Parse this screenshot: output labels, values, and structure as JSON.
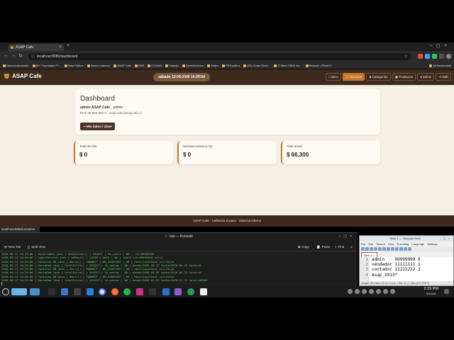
{
  "browser": {
    "tab_title": "ASAP Cafe",
    "new_tab": "+",
    "url": "localhost:8080/dashboard",
    "bookmarks": [
      "Demo/colorandrio",
      "40+ Foundation™...",
      "Java Python",
      "Nuevo carbono",
      "ASAP Cafe",
      "DBS",
      "CASADI",
      "Trabajo",
      "CyberDefense",
      "Viajes",
      "PR/Ladillos",
      "(21) Como Decir...",
      "17 Best OBDII An...",
      "Resume | FlowCV"
    ],
    "all_bookmarks": "All Bookmarks",
    "status_url": "localhost:8080/usuarios"
  },
  "app": {
    "brand": "ASAP Cafe",
    "datetime": "sábado 12-09-2026 14:29:54",
    "nav": [
      {
        "label": "Inicio",
        "icon": "home-icon",
        "active": false
      },
      {
        "label": "Usuarios",
        "icon": "users-icon",
        "active": true
      },
      {
        "label": "Categorías",
        "icon": "tag-icon",
        "active": false
      },
      {
        "label": "Productos",
        "icon": "box-icon",
        "active": false
      },
      {
        "label": "admin",
        "icon": "user-icon",
        "active": false
      },
      {
        "label": "Salir",
        "icon": "logout-icon",
        "active": false
      }
    ],
    "dashboard": {
      "title": "Dashboard",
      "user_name": "admin ASAP Cafe",
      "user_role": "· admin",
      "rut_line": "RUT 99.999.999-9 · asapcafe@asapcafe.cl",
      "button": "Mis datos / clave"
    },
    "stats": [
      {
        "label": "Total del día",
        "value": "$ 0"
      },
      {
        "label": "Semana actual (L-D)",
        "value": "$ 0"
      },
      {
        "label": "Total anual",
        "value": "$ 66,300"
      }
    ],
    "footer": "ASAP Cafe · Cafetería al paso · Sistema interno"
  },
  "terminal": {
    "title": "~ : bat — Konsole",
    "new_tab": "New Tab",
    "split_view": "Split View",
    "copy": "Copy",
    "paste": "Paste",
    "find": "Find",
    "lines": [
      "2026-09-12 14:29:08 | UsuarioDao.java | autenticar() | SELECT | tb_users | OK | rut=99999999",
      "2026-09-12 14:29:08 | LoginServlet.java | doPost() | LOGIN | AUTH | OK | idu=1 rut=99999999 rol=1",
      "2026-09-12 14:29:08 | Conexion DB.java | abrir() | CONNECT | DB_ASAPCAFE | OK | host=localhost ssl=false",
      "2026-09-12 14:29:08 | VentaDao.java | totalEntre() | SELECT | tb_ventas | OK | desde=2026-09-12 hasta=2026-09-12 total=0",
      "2026-09-12 14:29:08 | Conexion DB.java | abrir() | CONNECT | DB_ASAPCAFE | OK | host=localhost ssl=false",
      "2026-09-12 14:29:08 | VentaDao.java | totalEntre() | SELECT | tb_ventas | OK | desde=2026-09-07 hasta=2026-09-13 total=0",
      "2026-09-12 14:29:08 | Conexion DB.java | abrir() | CONNECT | DB_ASAPCAFE | OK | host=localhost ssl=false",
      "2026-09-12 14:29:08 | VentaDao.java | totalEntre() | SELECT | tb_ventas | OK | desde=2026-01-01 hasta=2026-12-31 total=66300"
    ],
    "cursor": "▌"
  },
  "notepad": {
    "title": "*New 1 — Notepad Next",
    "menu": [
      "File",
      "Edit",
      "Search",
      "View",
      "Encoding",
      "Language",
      "Settings"
    ],
    "tab": "New 1",
    "line_numbers": [
      "1",
      "2",
      "3",
      "4"
    ],
    "lines": [
      "admin    99999999 9",
      "vendedor 11111111 1",
      "contador 22222222 2",
      "Asap_2013*"
    ],
    "status": "Length: 99    Lines: 14    Ln: 4    Col: 1    Sel: 11 | 1    Unix (LF)    UTF-8"
  },
  "taskbar": {
    "time": "2:29 PM",
    "date": "9/12/26"
  },
  "colors": {
    "accent": "#c8782c",
    "nav_bg": "#3d2a1d",
    "page_bg": "#f5efe6",
    "terminal_text": "#5fd35f"
  }
}
